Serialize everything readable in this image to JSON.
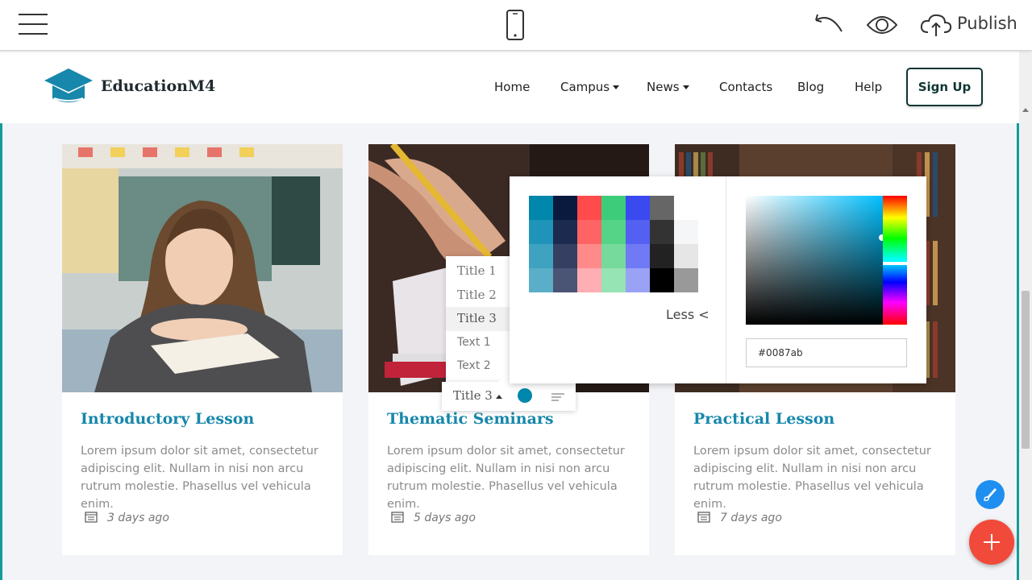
{
  "editor": {
    "publish_label": "Publish",
    "icons": [
      "menu-icon",
      "mobile-view-icon",
      "undo-icon",
      "preview-eye-icon",
      "cloud-upload-icon"
    ]
  },
  "site": {
    "brand": "EducationM4",
    "nav": {
      "items": [
        "Home",
        "Campus",
        "News",
        "Contacts",
        "Blog",
        "Help"
      ],
      "signup": "Sign Up"
    },
    "cards": [
      {
        "title": "Introductory Lesson",
        "desc": "Lorem ipsum dolor sit amet, consectetur adipiscing elit. Nullam in nisi non arcu rutrum molestie. Phasellus vel vehicula enim.",
        "date": "3 days ago"
      },
      {
        "title": "Thematic Seminars",
        "desc": "Lorem ipsum dolor sit amet, consectetur adipiscing elit. Nullam in nisi non arcu rutrum molestie. Phasellus vel vehicula enim.",
        "date": "5 days ago"
      },
      {
        "title": "Practical Lesson",
        "desc": "Lorem ipsum dolor sit amet, consectetur adipiscing elit. Nullam in nisi non arcu rutrum molestie. Phasellus vel vehicula enim.",
        "date": "7 days ago"
      }
    ]
  },
  "text_style_menu": {
    "options": [
      "Title 1",
      "Title 2",
      "Title 3",
      "Text 1",
      "Text 2"
    ],
    "selected": "Title 3"
  },
  "color_picker": {
    "hex_value": "#0087ab",
    "less_label": "Less <",
    "current_color": "#0087ab",
    "palette": [
      [
        "#0087ab",
        "#0a1a3e",
        "#ff4b4b",
        "#3dcc7a",
        "#3a49f0",
        "#666666"
      ],
      [
        "#2094b8",
        "#1c2a50",
        "#ff6464",
        "#55d487",
        "#5360f2",
        "#333333",
        "#f5f6f8"
      ],
      [
        "#40a2c1",
        "#343f62",
        "#ff8a8a",
        "#75da9c",
        "#6f7af4",
        "#222222",
        "#e6e6e6"
      ],
      [
        "#5aaec8",
        "#4a5474",
        "#ffaeb3",
        "#96e3b3",
        "#9aa2f6",
        "#000000",
        "#999999"
      ]
    ]
  },
  "colors": {
    "brand_blue": "#1787ab",
    "teal_accent": "#149c9c",
    "fab_edit": "#1e8ff0",
    "fab_add": "#f14a3a"
  }
}
